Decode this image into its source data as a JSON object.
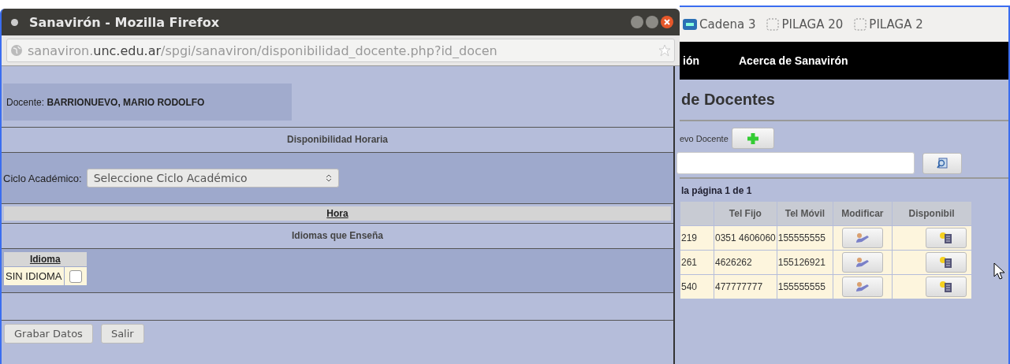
{
  "popup": {
    "title": "Sanavirón - Mozilla Firefox",
    "url": {
      "host_start": "sanaviron.",
      "host": "unc.edu.ar",
      "path": "/spgi/sanaviron/disponibilidad_docente.php?id_docen"
    },
    "docente": "Docente: **BARRIONUEVO, MARIO RODOLFO**",
    "section_title": "Disponibilidad Horaria",
    "ciclo": {
      "label": "Ciclo Académico:",
      "select_value": "Seleccione Ciclo Académico"
    },
    "hora_header": "Hora",
    "idiomas_title": "Idiomas que Enseña",
    "idiomas": {
      "header": "Idioma",
      "rows": [
        {
          "name": "SIN IDIOMA",
          "checked": false
        }
      ]
    },
    "buttons": [
      "Grabar Datos",
      "Salir"
    ]
  },
  "background": {
    "bookmarks": [
      {
        "label": "Cadena 3",
        "kind": "logo"
      },
      {
        "label": "PILAGA 20",
        "kind": "blank"
      },
      {
        "label": "PILAGA 2",
        "kind": "blank"
      }
    ],
    "menu": [
      "ión",
      "Acerca de Sanavirón"
    ],
    "heading": "de Docentes",
    "new_label": "evo Docente",
    "pagination": "la página 1 de 1",
    "table": {
      "columns": [
        "",
        "Tel Fijo",
        "Tel Móvil",
        "Modificar",
        "Disponibil"
      ],
      "rows": [
        [
          "219",
          "0351 4606060",
          "155555555"
        ],
        [
          "261",
          "4626262",
          "155126921"
        ],
        [
          "540",
          "477777777",
          "155555555"
        ]
      ]
    }
  }
}
